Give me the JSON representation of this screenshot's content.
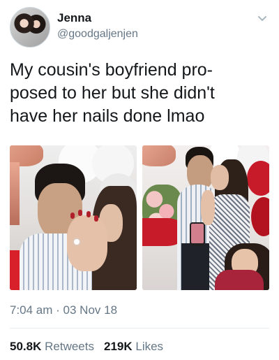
{
  "user": {
    "display_name": "Jenna",
    "handle": "@goodgaljenjen"
  },
  "tweet": {
    "text": "My cousin's boyfriend pro-\nposed to her but she didn't\nhave her nails done lmao",
    "timestamp": "7:04 am · 03 Nov 18"
  },
  "stats": {
    "retweets_count": "50.8K",
    "retweets_label": "Retweets",
    "likes_count": "219K",
    "likes_label": "Likes"
  },
  "icons": {
    "menu": "chevron-down-icon"
  },
  "colors": {
    "text": "#14171a",
    "secondary": "#657786",
    "divider": "#e6ecf0",
    "nail_red": "#c0392b"
  }
}
